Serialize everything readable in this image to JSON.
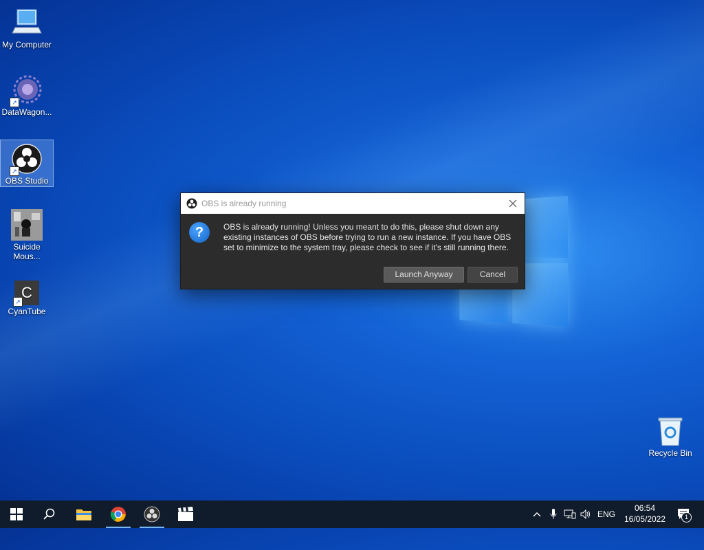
{
  "desktop": {
    "icons": [
      {
        "label": "My Computer",
        "icon": "computer-icon"
      },
      {
        "label": "DataWagon...",
        "icon": "datawagon-icon"
      },
      {
        "label": "OBS Studio",
        "icon": "obs-icon"
      },
      {
        "label": "Suicide Mous...",
        "icon": "suicide-mouse-icon"
      },
      {
        "label": "CyanTube",
        "icon": "cyantube-icon",
        "glyph": "C"
      },
      {
        "label": "Recycle Bin",
        "icon": "recycle-bin-icon"
      }
    ]
  },
  "dialog": {
    "title": "OBS is already running",
    "message": "OBS is already running! Unless you meant to do this, please shut down any existing instances of OBS before trying to run a new instance. If you have OBS set to minimize to the system tray, please check to see if it's still running there.",
    "question_glyph": "?",
    "buttons": {
      "launch": "Launch Anyway",
      "cancel": "Cancel"
    }
  },
  "taskbar": {
    "apps": [
      "start-icon",
      "search-icon",
      "file-explorer-icon",
      "chrome-icon",
      "obs-icon",
      "video-editor-icon"
    ],
    "tray": {
      "language": "ENG",
      "time": "06:54",
      "date": "16/05/2022",
      "notification_count": "1"
    }
  },
  "colors": {
    "accent": "#79b8f3",
    "dialog_bg": "#2c2c2c",
    "taskbar_bg": "#101b2b"
  }
}
